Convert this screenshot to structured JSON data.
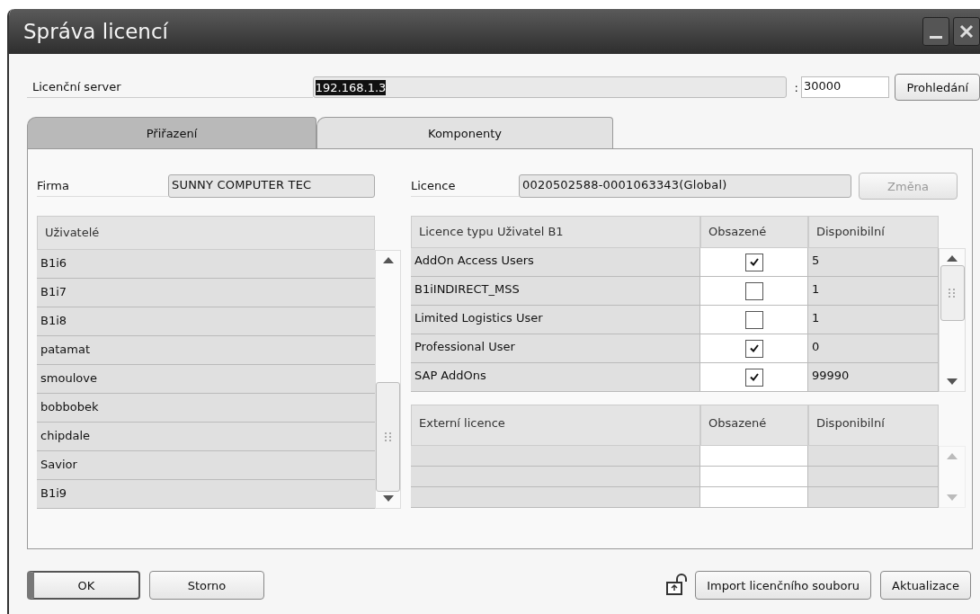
{
  "window": {
    "title": "Správa licencí"
  },
  "server": {
    "label": "Licenční server",
    "address": "192.168.1.3",
    "separator": ":",
    "port": "30000",
    "browse_button": "Prohledání"
  },
  "tabs": [
    {
      "label": "Přiřazení",
      "selected": true
    },
    {
      "label": "Komponenty",
      "selected": false
    }
  ],
  "company": {
    "label": "Firma",
    "value": "SUNNY COMPUTER TEC"
  },
  "licence": {
    "label": "Licence",
    "value": "0020502588-0001063343(Global)",
    "button": {
      "label": "Změna",
      "disabled": true
    }
  },
  "users": {
    "header": "Uživatelé",
    "items": [
      "B1i6",
      "B1i7",
      "B1i8",
      "patamat",
      "smoulove",
      "bobbobek",
      "chipdale",
      "Savior",
      "B1i9"
    ]
  },
  "licence_table": {
    "columns": [
      "Licence typu Uživatel B1",
      "Obsazené",
      "Disponibilní"
    ],
    "rows": [
      {
        "name": "AddOn Access Users",
        "checked": true,
        "available": "5"
      },
      {
        "name": "B1iINDIRECT_MSS",
        "checked": false,
        "available": "1"
      },
      {
        "name": "Limited Logistics User",
        "checked": false,
        "available": "1"
      },
      {
        "name": "Professional User",
        "checked": true,
        "available": "0"
      },
      {
        "name": "SAP AddOns",
        "checked": true,
        "available": "99990"
      }
    ]
  },
  "external_table": {
    "columns": [
      "Externí licence",
      "Obsazené",
      "Disponibilní"
    ]
  },
  "footer": {
    "ok": "OK",
    "cancel": "Storno",
    "import": "Import licenčního souboru",
    "update": "Aktualizace"
  }
}
